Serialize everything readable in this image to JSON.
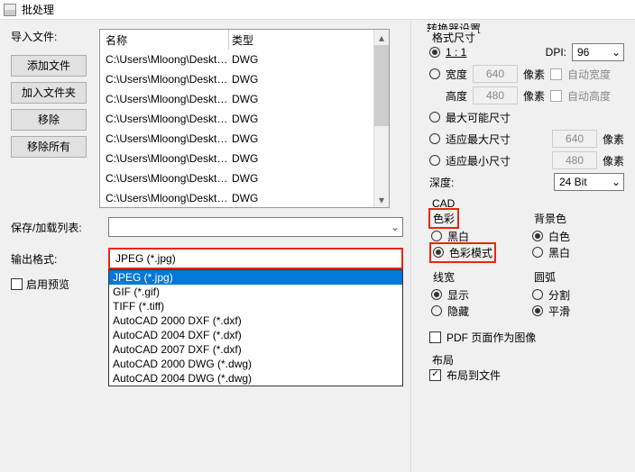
{
  "title": "批处理",
  "left": {
    "import_label": "导入文件:",
    "buttons": {
      "add_file": "添加文件",
      "add_folder": "加入文件夹",
      "remove": "移除",
      "remove_all": "移除所有"
    },
    "cols": {
      "name": "名称",
      "type": "类型"
    },
    "files": [
      {
        "name": "C:\\Users\\Mloong\\Deskt…",
        "type": "DWG"
      },
      {
        "name": "C:\\Users\\Mloong\\Deskt…",
        "type": "DWG"
      },
      {
        "name": "C:\\Users\\Mloong\\Deskt…",
        "type": "DWG"
      },
      {
        "name": "C:\\Users\\Mloong\\Deskt…",
        "type": "DWG"
      },
      {
        "name": "C:\\Users\\Mloong\\Deskt…",
        "type": "DWG"
      },
      {
        "name": "C:\\Users\\Mloong\\Deskt…",
        "type": "DWG"
      },
      {
        "name": "C:\\Users\\Mloong\\Deskt…",
        "type": "DWG"
      },
      {
        "name": "C:\\Users\\Mloong\\Deskt…",
        "type": "DWG"
      }
    ],
    "save_list_label": "保存/加载列表:",
    "save_list_value": "",
    "output_label": "输出格式:",
    "output_value": "JPEG (*.jpg)",
    "output_options": [
      "JPEG (*.jpg)",
      "GIF (*.gif)",
      "TIFF (*.tiff)",
      "AutoCAD 2000 DXF (*.dxf)",
      "AutoCAD 2004 DXF (*.dxf)",
      "AutoCAD 2007 DXF (*.dxf)",
      "AutoCAD 2000 DWG (*.dwg)",
      "AutoCAD 2004 DWG (*.dwg)"
    ],
    "preview_label": "启用预览"
  },
  "right": {
    "converter_legend": "转换器设置",
    "format_legend": "格式尺寸",
    "one_to_one": "1 : 1",
    "dpi_label": "DPI:",
    "dpi_value": "96",
    "width_label": "宽度",
    "width_value": "640",
    "px": "像素",
    "auto_w": "自动宽度",
    "height_label": "高度",
    "height_value": "480",
    "auto_h": "自动高度",
    "max_poss": "最大可能尺寸",
    "fit_max": "适应最大尺寸",
    "fit_max_val": "640",
    "fit_min": "适应最小尺寸",
    "fit_min_val": "480",
    "depth_label": "深度:",
    "depth_value": "24 Bit",
    "cad_legend": "CAD",
    "color_legend": "色彩",
    "color_bw": "黑白",
    "color_mode": "色彩模式",
    "bg_legend": "背景色",
    "bg_white": "白色",
    "bg_black": "黑白",
    "lw_legend": "线宽",
    "lw_show": "显示",
    "lw_hide": "隐藏",
    "arc_legend": "圆弧",
    "arc_split": "分割",
    "arc_smooth": "平滑",
    "pdf_img": "PDF 页面作为图像",
    "layout_legend": "布局",
    "layout_to_file": "布局到文件"
  }
}
